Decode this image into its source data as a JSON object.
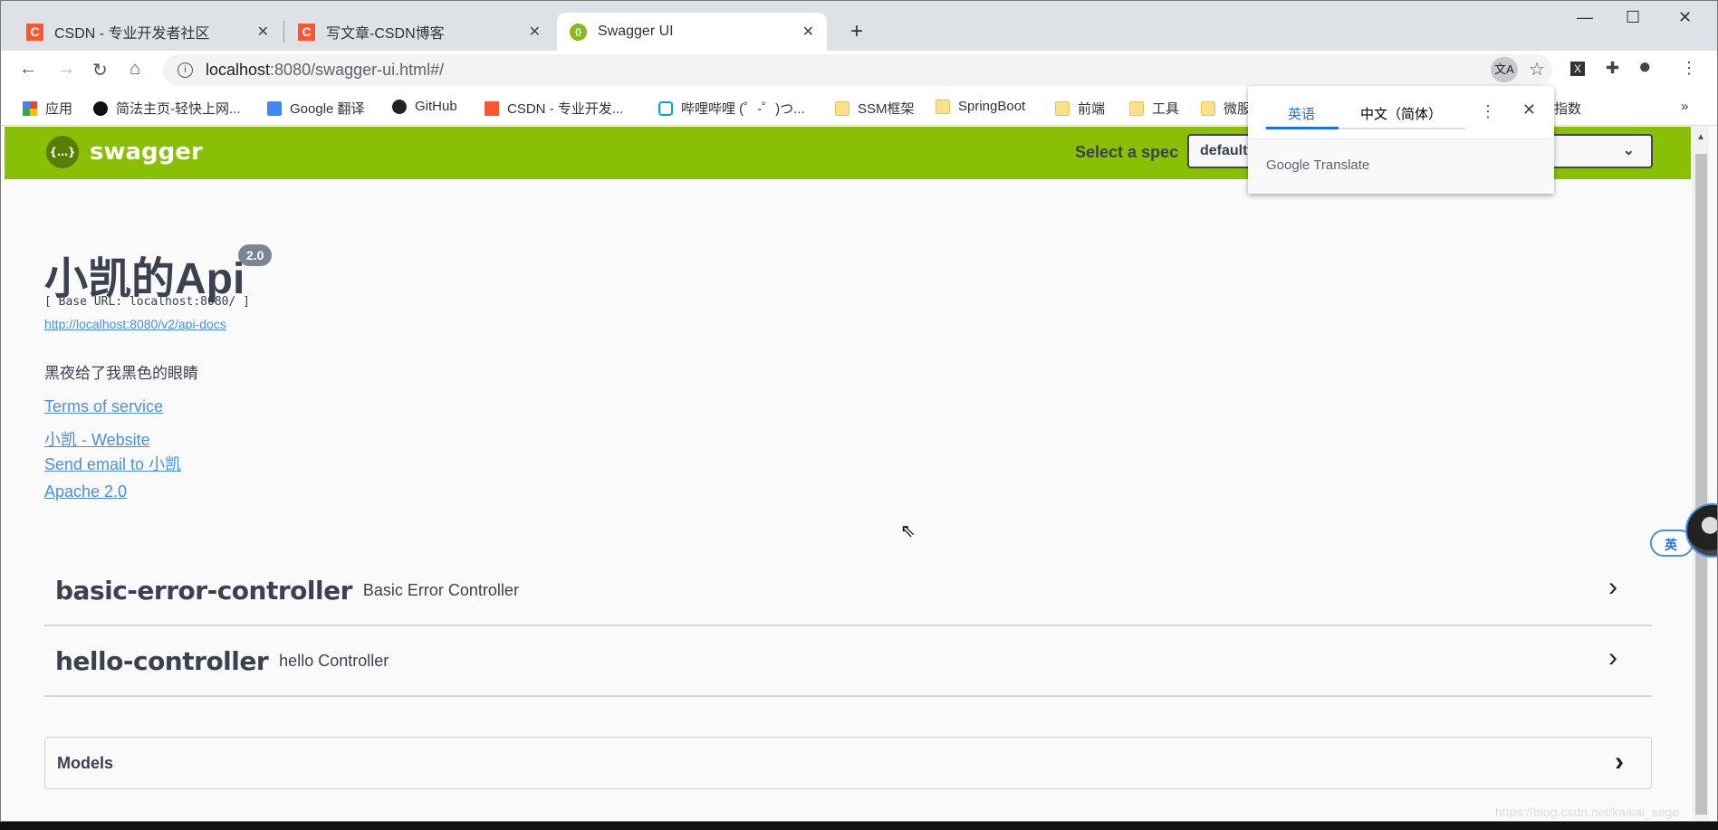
{
  "browser": {
    "tabs": [
      {
        "title": "CSDN - 专业开发者社区",
        "icon": "csdn-icon"
      },
      {
        "title": "写文章-CSDN博客",
        "icon": "csdn-icon"
      },
      {
        "title": "Swagger UI",
        "icon": "swagger-icon",
        "active": true
      }
    ],
    "new_tab": "+",
    "url_host": "localhost",
    "url_rest": ":8080/swagger-ui.html#/",
    "bookmarks": [
      {
        "label": "应用",
        "icon": "apps-grid-icon"
      },
      {
        "label": "简法主页-轻快上网...",
        "icon": "jianfa-icon"
      },
      {
        "label": "Google 翻译",
        "icon": "google-translate-icon"
      },
      {
        "label": "GitHub",
        "icon": "github-icon"
      },
      {
        "label": "CSDN - 专业开发...",
        "icon": "csdn-icon"
      },
      {
        "label": "哔哩哔哩 (゜-゜)つ...",
        "icon": "bilibili-icon"
      },
      {
        "label": "SSM框架",
        "icon": "folder-icon"
      },
      {
        "label": "SpringBoot",
        "icon": "folder-icon"
      },
      {
        "label": "前端",
        "icon": "folder-icon"
      },
      {
        "label": "工具",
        "icon": "folder-icon"
      },
      {
        "label": "微服",
        "icon": "folder-icon"
      },
      {
        "label": "度指数",
        "icon": "folder-icon"
      }
    ],
    "bookmarks_more": "»"
  },
  "translate_popup": {
    "tab_source": "英语",
    "tab_target": "中文（简体）",
    "footer_google": "Google",
    "footer_translate": "Translate"
  },
  "swagger": {
    "brand": "swagger",
    "select_label": "Select a spec",
    "select_value": "default",
    "title": "小凯的Api",
    "version": "2.0",
    "base_url": "[ Base URL: localhost:8080/ ]",
    "api_docs": "http://localhost:8080/v2/api-docs",
    "description": "黑夜给了我黑色的眼睛",
    "terms": "Terms of service",
    "website": "小凯 - Website",
    "email": "Send email to 小凯",
    "license": "Apache 2.0",
    "controllers": [
      {
        "name": "basic-error-controller",
        "desc": "Basic Error Controller"
      },
      {
        "name": "hello-controller",
        "desc": "hello Controller"
      }
    ],
    "models": "Models"
  },
  "float_button": "英",
  "watermark": "https://blog.csdn.net/kaikai_sege",
  "colors": {
    "swagger_green": "#89bf04",
    "link": "#4990e2",
    "text": "#3b4151"
  }
}
